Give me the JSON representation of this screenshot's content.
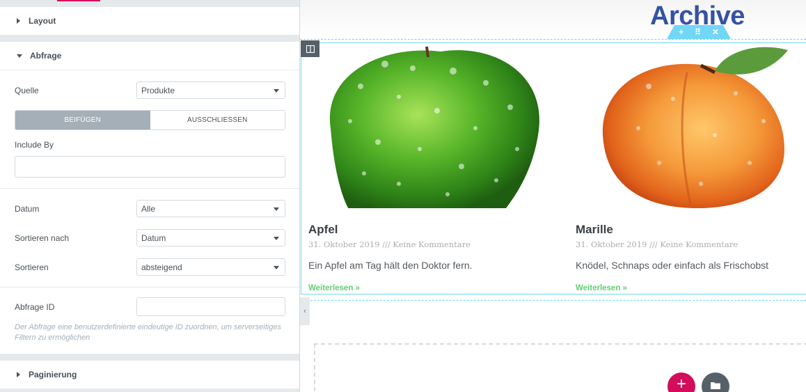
{
  "panel": {
    "sections": {
      "layout": "Layout",
      "abfrage": "Abfrage",
      "paginierung": "Paginierung"
    },
    "abfrage": {
      "quelle_label": "Quelle",
      "quelle_value": "Produkte",
      "tab_include": "BEIFÜGEN",
      "tab_exclude": "AUSSCHLIESSEN",
      "include_by_label": "Include By",
      "datum_label": "Datum",
      "datum_value": "Alle",
      "sortieren_nach_label": "Sortieren nach",
      "sortieren_nach_value": "Datum",
      "sortieren_label": "Sortieren",
      "sortieren_value": "absteigend",
      "abfrage_id_label": "Abfrage ID",
      "abfrage_id_description": "Der Abfrage eine benutzerdefinierte eindeutige ID zuordnen, um serverseitiges Filtern zu ermöglichen"
    }
  },
  "preview": {
    "archive_title": "Archive",
    "posts": [
      {
        "title": "Apfel",
        "meta": "31. Oktober 2019 /// Keine Kommentare",
        "excerpt": "Ein Apfel am Tag hält den Doktor fern.",
        "read_more": "Weiterlesen »",
        "image": "green-apple-image"
      },
      {
        "title": "Marille",
        "meta": "31. Oktober 2019 /// Keine Kommentare",
        "excerpt": "Knödel, Schnaps oder einfach als Frischobst",
        "read_more": "Weiterlesen »",
        "image": "apricot-image"
      }
    ],
    "section_handle": {
      "add": "+",
      "move": "⠿",
      "close": "✕"
    },
    "fab_add": "+",
    "collapse_arrow": "‹"
  },
  "colors": {
    "accent_pink": "#d30c5c",
    "link_green": "#61ce70",
    "title_blue": "#3552a3",
    "frame_cyan": "#71d7f7",
    "tab_active": "#a4afb7"
  }
}
